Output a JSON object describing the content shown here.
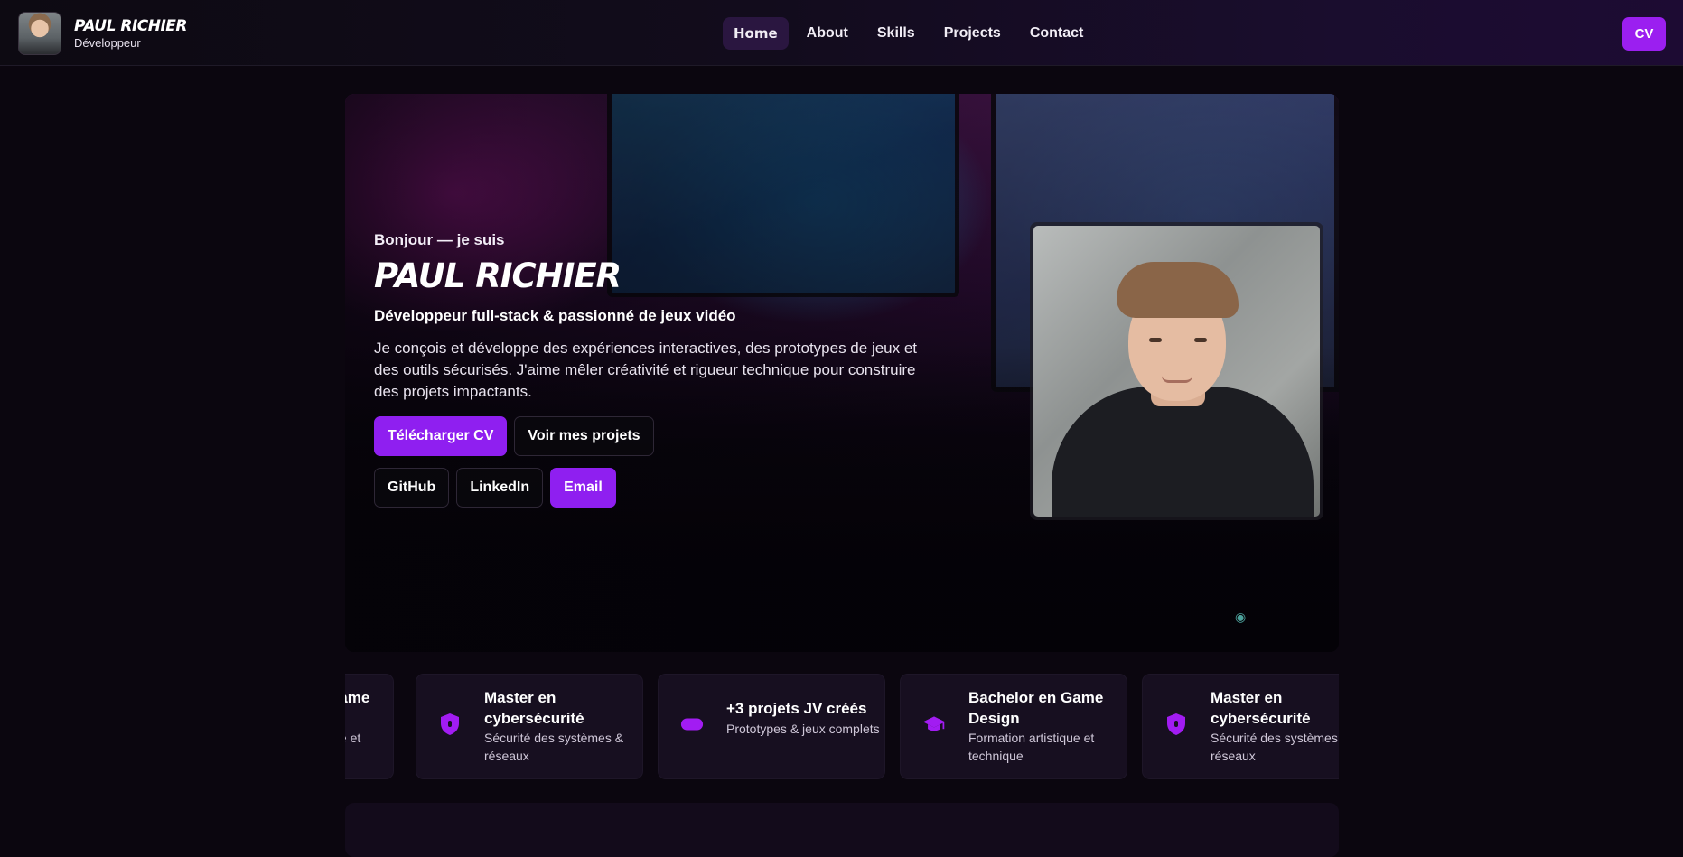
{
  "nav": {
    "brand_name": "Paul Richier",
    "brand_role": "Développeur",
    "links": [
      "Home",
      "About",
      "Skills",
      "Projects",
      "Contact"
    ],
    "cv_label": "CV"
  },
  "hero": {
    "greeting": "Bonjour — je suis",
    "name": "Paul Richier",
    "subtitle": "Développeur full-stack & passionné de jeux vidéo",
    "description": "Je conçois et développe des expériences interactives, des prototypes de jeux et des outils sécurisés. J'aime mêler créativité et rigueur technique pour construire des projets impactants.",
    "buttons": {
      "download_cv": "Télécharger CV",
      "view_projects": "Voir mes projets"
    },
    "socials": {
      "github": "GitHub",
      "linkedin": "LinkedIn",
      "email": "Email"
    }
  },
  "stats": [
    {
      "icon": "graduation-cap-icon",
      "title": "Bachelor en Game Design",
      "desc": "Formation artistique et technique"
    },
    {
      "icon": "shield-icon",
      "title": "Master en cybersécurité",
      "desc": "Sécurité des systèmes & réseaux"
    },
    {
      "icon": "gamepad-icon",
      "title": "+3 projets JV créés",
      "desc": "Prototypes & jeux complets"
    },
    {
      "icon": "graduation-cap-icon",
      "title": "Bachelor en Game Design",
      "desc": "Formation artistique et technique"
    },
    {
      "icon": "shield-icon",
      "title": "Master en cybersécurité",
      "desc": "Sécurité des systèmes & réseaux"
    }
  ],
  "colors": {
    "accent": "#8f1ff0",
    "background": "#0b060f",
    "card": "#170f20"
  }
}
